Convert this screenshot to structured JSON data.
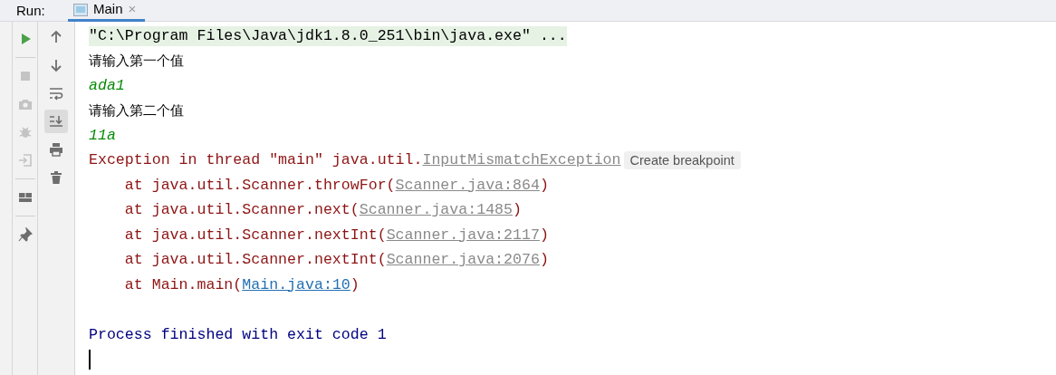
{
  "run_panel": {
    "label": "Run:",
    "tabs": [
      {
        "title": "Main",
        "close": "×",
        "selected": true
      }
    ]
  },
  "toolbar_primary": [
    {
      "kind": "run",
      "disabled": false
    },
    {
      "kind": "stop",
      "disabled": true
    },
    {
      "kind": "camera",
      "disabled": true
    },
    {
      "kind": "debug",
      "disabled": true
    },
    {
      "kind": "exit",
      "disabled": true
    },
    {
      "kind": "layout",
      "disabled": false
    },
    {
      "kind": "pin",
      "disabled": false
    }
  ],
  "toolbar_secondary": [
    {
      "kind": "up",
      "selected": false
    },
    {
      "kind": "down",
      "selected": false
    },
    {
      "kind": "wrap",
      "selected": false
    },
    {
      "kind": "scroll_end",
      "selected": true
    },
    {
      "kind": "print",
      "selected": false
    },
    {
      "kind": "trash",
      "selected": false
    }
  ],
  "console": [
    {
      "kind": "command",
      "parts": [
        {
          "kind": "text",
          "text": "\"C:\\Program Files\\Java\\jdk1.8.0_251\\bin\\java.exe\" ..."
        }
      ]
    },
    {
      "kind": "output",
      "parts": [
        {
          "kind": "text",
          "text": "请输入第一个值"
        }
      ]
    },
    {
      "kind": "input",
      "parts": [
        {
          "kind": "text",
          "text": "ada1"
        }
      ]
    },
    {
      "kind": "output",
      "parts": [
        {
          "kind": "text",
          "text": "请输入第二个值"
        }
      ]
    },
    {
      "kind": "input",
      "parts": [
        {
          "kind": "text",
          "text": "11a"
        }
      ]
    },
    {
      "kind": "error",
      "parts": [
        {
          "kind": "text",
          "text": "Exception in thread \"main\" java.util."
        },
        {
          "kind": "lib_link",
          "text": "InputMismatchException"
        },
        {
          "kind": "button",
          "text": "Create breakpoint"
        }
      ]
    },
    {
      "kind": "error",
      "parts": [
        {
          "kind": "text",
          "text": "    at java.util.Scanner.throwFor("
        },
        {
          "kind": "lib_link",
          "text": "Scanner.java:864"
        },
        {
          "kind": "text",
          "text": ")"
        }
      ]
    },
    {
      "kind": "error",
      "parts": [
        {
          "kind": "text",
          "text": "    at java.util.Scanner.next("
        },
        {
          "kind": "lib_link",
          "text": "Scanner.java:1485"
        },
        {
          "kind": "text",
          "text": ")"
        }
      ]
    },
    {
      "kind": "error",
      "parts": [
        {
          "kind": "text",
          "text": "    at java.util.Scanner.nextInt("
        },
        {
          "kind": "lib_link",
          "text": "Scanner.java:2117"
        },
        {
          "kind": "text",
          "text": ")"
        }
      ]
    },
    {
      "kind": "error",
      "parts": [
        {
          "kind": "text",
          "text": "    at java.util.Scanner.nextInt("
        },
        {
          "kind": "lib_link",
          "text": "Scanner.java:2076"
        },
        {
          "kind": "text",
          "text": ")"
        }
      ]
    },
    {
      "kind": "error",
      "parts": [
        {
          "kind": "text",
          "text": "    at Main.main("
        },
        {
          "kind": "user_link",
          "text": "Main.java:10"
        },
        {
          "kind": "text",
          "text": ")"
        }
      ]
    },
    {
      "kind": "blank"
    },
    {
      "kind": "process",
      "parts": [
        {
          "kind": "text",
          "text": "Process finished with exit code 1"
        }
      ]
    },
    {
      "kind": "cursor"
    }
  ]
}
